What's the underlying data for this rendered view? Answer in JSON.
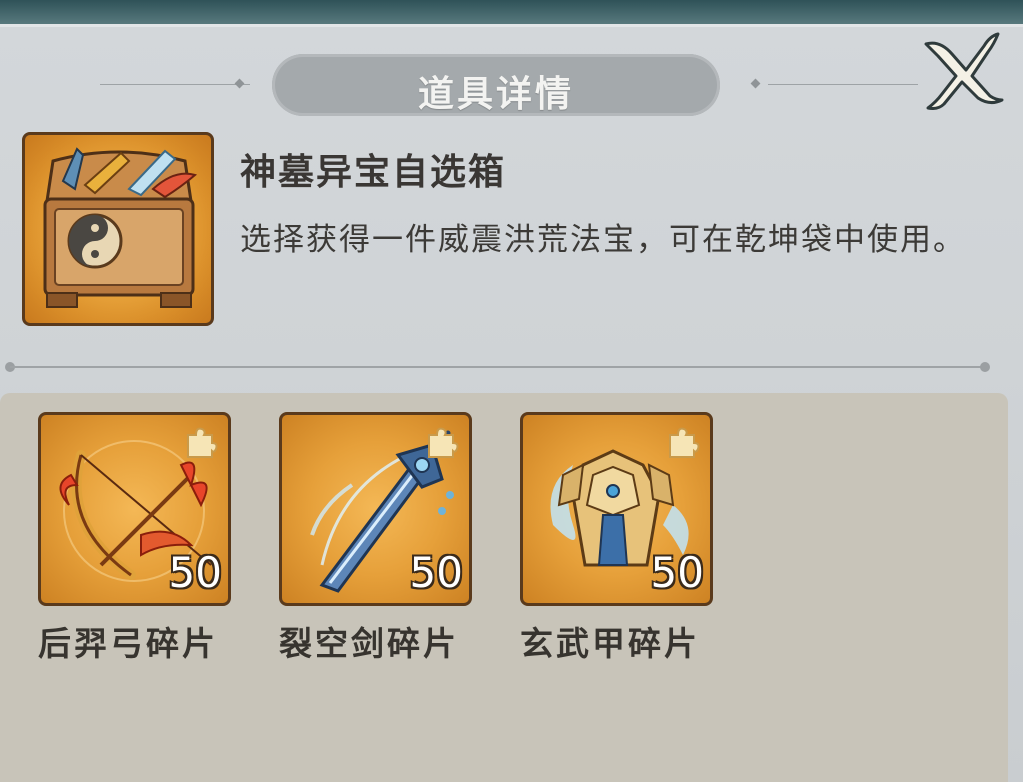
{
  "dialog": {
    "title": "道具详情"
  },
  "item": {
    "name": "神墓异宝自选箱",
    "description": "选择获得一件威震洪荒法宝，可在乾坤袋中使用。",
    "icon": "treasure-chest-icon"
  },
  "fragments": [
    {
      "name": "后羿弓碎片",
      "count": "50",
      "icon": "bow-icon"
    },
    {
      "name": "裂空剑碎片",
      "count": "50",
      "icon": "sword-icon"
    },
    {
      "name": "玄武甲碎片",
      "count": "50",
      "icon": "armor-icon"
    }
  ],
  "colors": {
    "panel": "#d3d7da",
    "banner": "#a4a9ac",
    "frame_gold": "#e39a30",
    "frame_border": "#5a3a1c",
    "bottom_area": "#c8c4b9"
  }
}
